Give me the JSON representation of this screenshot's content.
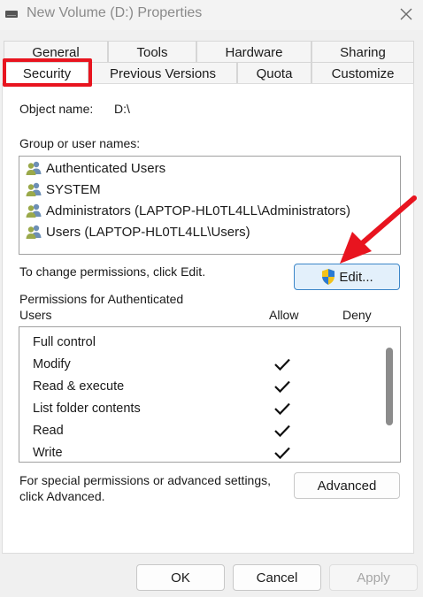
{
  "window": {
    "title": "New Volume (D:) Properties",
    "icons": {
      "drive": "drive-icon",
      "close": "close-icon"
    }
  },
  "tabs": {
    "row1": [
      "General",
      "Tools",
      "Hardware",
      "Sharing"
    ],
    "row2": [
      "Security",
      "Previous Versions",
      "Quota",
      "Customize"
    ],
    "active": "Security"
  },
  "security": {
    "object_name_label": "Object name:",
    "object_name_value": "D:\\",
    "group_label": "Group or user names:",
    "users": [
      "Authenticated Users",
      "SYSTEM",
      "Administrators (LAPTOP-HL0TL4LL\\Administrators)",
      "Users (LAPTOP-HL0TL4LL\\Users)"
    ],
    "change_text": "To change permissions, click Edit.",
    "edit_button": "Edit...",
    "permissions_label_line1": "Permissions for Authenticated",
    "permissions_label_line2": "Users",
    "allow_header": "Allow",
    "deny_header": "Deny",
    "permissions": [
      {
        "name": "Full control",
        "allow": false,
        "deny": false
      },
      {
        "name": "Modify",
        "allow": true,
        "deny": false
      },
      {
        "name": "Read & execute",
        "allow": true,
        "deny": false
      },
      {
        "name": "List folder contents",
        "allow": true,
        "deny": false
      },
      {
        "name": "Read",
        "allow": true,
        "deny": false
      },
      {
        "name": "Write",
        "allow": true,
        "deny": false
      }
    ],
    "special_text_line1": "For special permissions or advanced settings,",
    "special_text_line2": "click Advanced.",
    "advanced_button": "Advanced"
  },
  "footer": {
    "ok": "OK",
    "cancel": "Cancel",
    "apply": "Apply"
  },
  "colors": {
    "annotation_red": "#e8141f",
    "primary_button_border": "#3c86c8",
    "primary_button_bg": "#e3f0fb"
  }
}
